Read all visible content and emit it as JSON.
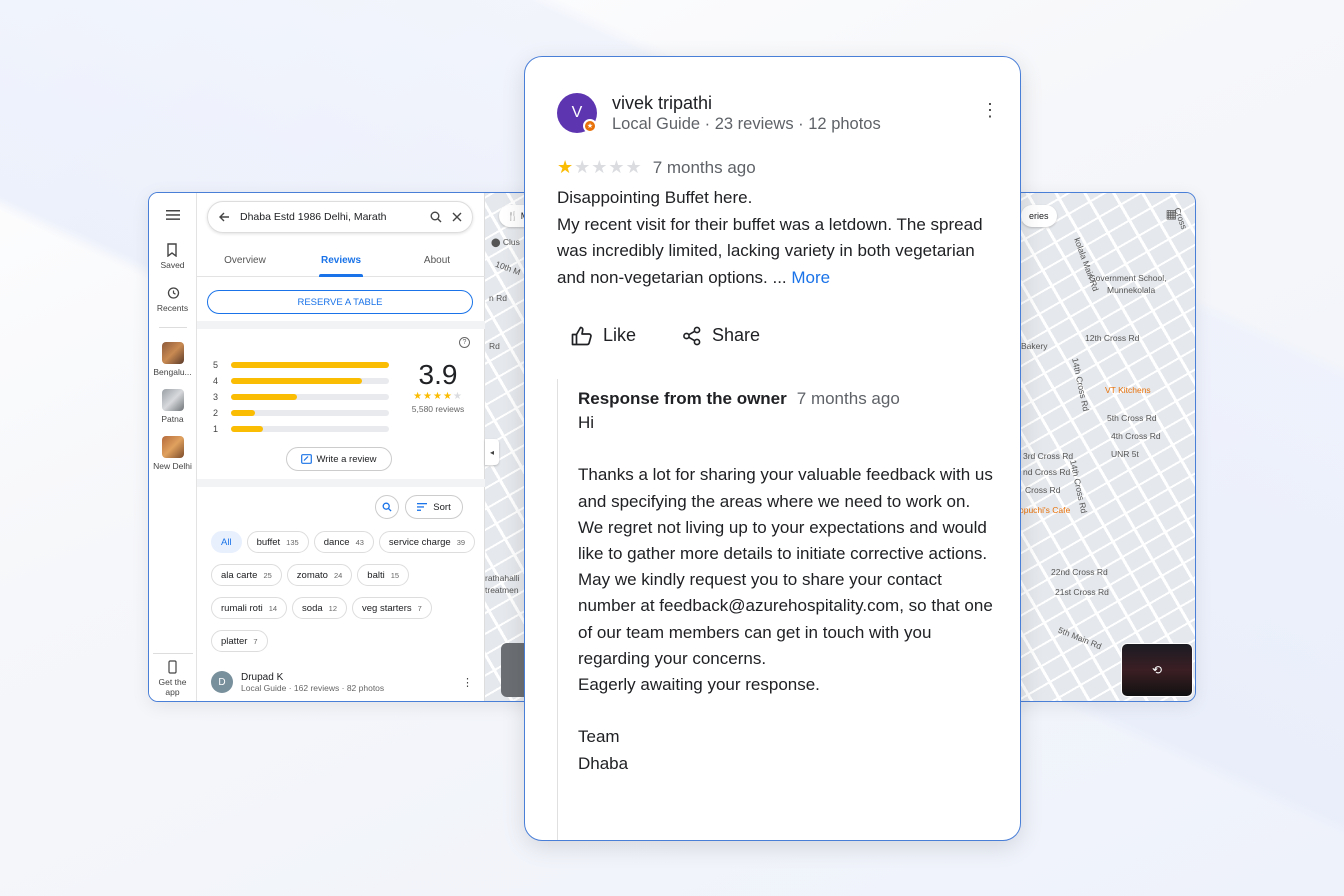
{
  "maps": {
    "rail": {
      "menu_icon": "menu-icon",
      "saved": "Saved",
      "recents": "Recents",
      "recent_places": [
        "Bengalu...",
        "Patna",
        "New Delhi"
      ],
      "get_app": "Get the app"
    },
    "search": {
      "query": "Dhaba Estd 1986 Delhi, Marath"
    },
    "tabs": [
      "Overview",
      "Reviews",
      "About"
    ],
    "active_tab": "Reviews",
    "reserve_label": "RESERVE A TABLE",
    "rating": {
      "average": "3.9",
      "stars": "★★★★",
      "star_off": "★",
      "count_label": "5,580 reviews",
      "distribution": [
        {
          "stars": "5",
          "fraction": 1.0
        },
        {
          "stars": "4",
          "fraction": 0.83
        },
        {
          "stars": "3",
          "fraction": 0.42
        },
        {
          "stars": "2",
          "fraction": 0.15
        },
        {
          "stars": "1",
          "fraction": 0.2
        }
      ]
    },
    "write_review": "Write a review",
    "sort_label": "Sort",
    "chips": [
      {
        "label": "All",
        "count": ""
      },
      {
        "label": "buffet",
        "count": "135"
      },
      {
        "label": "dance",
        "count": "43"
      },
      {
        "label": "service charge",
        "count": "39"
      },
      {
        "label": "ala carte",
        "count": "25"
      },
      {
        "label": "zomato",
        "count": "24"
      },
      {
        "label": "balti",
        "count": "15"
      },
      {
        "label": "rumali roti",
        "count": "14"
      },
      {
        "label": "soda",
        "count": "12"
      },
      {
        "label": "veg starters",
        "count": "7"
      },
      {
        "label": "platter",
        "count": "7"
      }
    ],
    "mini_reviewer": {
      "initial": "D",
      "name": "Drupad K",
      "sub": "Local Guide · 162 reviews · 82 photos"
    },
    "map_labels": {
      "clus": "Clus",
      "tenth": "10th M",
      "nrd": "n Rd",
      "rd": "Rd",
      "rathahalli": "rathahalli",
      "treatmen": "treatmen",
      "kolala": "kolala Main Rd",
      "gov_school": "Government School,",
      "munnekolala": "Munnekolala",
      "cross12": "12th Cross Rd",
      "bakery": "Bakery",
      "vt": "VT Kitchens",
      "cross14": "14th Cross Rd",
      "cross5": "5th Cross Rd",
      "cross4": "4th Cross Rd",
      "unr": "UNR 5t",
      "cross3": "3rd Cross Rd",
      "cross2a": "nd Cross Rd",
      "cross2b": "Cross Rd",
      "cappuchi": "ppuchi's Cafe",
      "cross14b": "14th Cross Rd",
      "cross22": "22nd Cross Rd",
      "cross21": "21st Cross Rd",
      "main5": "5th Main Rd",
      "cross_r": "Cross",
      "eries": "eries"
    }
  },
  "review": {
    "initial": "V",
    "name": "vivek tripathi",
    "sub": "Local Guide · 23 reviews · 12 photos",
    "stars_on": "★",
    "stars_off": "★★★★",
    "when": "7 months ago",
    "title": "Disappointing Buffet here.",
    "text": "My recent visit for their buffet was a letdown. The spread was incredibly limited, lacking variety in both vegetarian and non-vegetarian options. ... ",
    "more": "More",
    "like": "Like",
    "share": "Share",
    "owner_title": "Response from the owner",
    "owner_when": "7 months ago",
    "owner_body": "Hi\n\nThanks a lot for sharing your valuable feedback with us and specifying the areas where we need to work on.\nWe regret not living up to your expectations and would like to gather more details to initiate corrective actions. May we kindly request you to share your contact number at feedback@azurehospitality.com, so that one of our team members can get in touch with you regarding your concerns.\nEagerly awaiting your response.\n\nTeam\nDhaba"
  },
  "colors": {
    "accent": "#1a73e8",
    "star": "#fbbc04",
    "card_border": "#4a7fd8",
    "avatar": "#5e35b1"
  }
}
